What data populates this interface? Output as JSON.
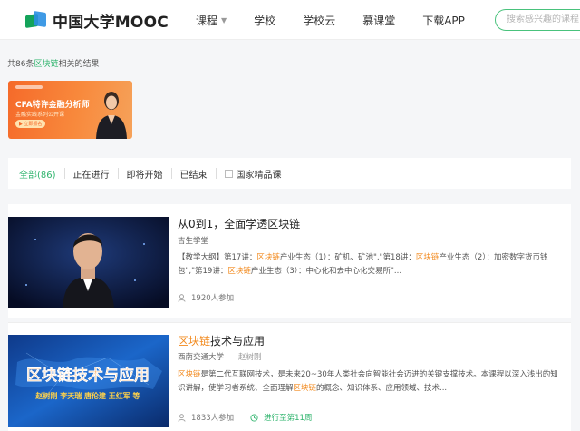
{
  "header": {
    "logo_text": "中国大学MOOC",
    "nav": [
      {
        "label": "课程",
        "has_dropdown": true
      },
      {
        "label": "学校",
        "has_dropdown": false
      },
      {
        "label": "学校云",
        "has_dropdown": false
      },
      {
        "label": "慕课堂",
        "has_dropdown": false
      },
      {
        "label": "下载APP",
        "has_dropdown": false
      }
    ],
    "search_placeholder": "搜索感兴趣的课程"
  },
  "results": {
    "prefix": "共86条",
    "keyword": "区块链",
    "suffix": "相关的结果"
  },
  "banner": {
    "title": "CFA特许金融分析师",
    "subtitle": "金融实践系列公开课",
    "tag": "▶ 立即报名"
  },
  "filters": {
    "items": [
      {
        "label": "全部(86)",
        "active": true
      },
      {
        "label": "正在进行",
        "active": false
      },
      {
        "label": "即将开始",
        "active": false
      },
      {
        "label": "已结束",
        "active": false
      }
    ],
    "checkbox_label": "国家精品课"
  },
  "courses": [
    {
      "title": "从0到1，全面学透区块链",
      "school": "吉生学堂",
      "teacher": "",
      "desc_parts": [
        {
          "t": "【教学大纲】第17讲：",
          "hl": false
        },
        {
          "t": "区块链",
          "hl": true
        },
        {
          "t": "产业生态（1）：矿机、矿池\",\"第18讲：",
          "hl": false
        },
        {
          "t": "区块链",
          "hl": true
        },
        {
          "t": "产业生态（2）：加密数字货币钱包\",\"第19讲：",
          "hl": false
        },
        {
          "t": "区块链",
          "hl": true
        },
        {
          "t": "产业生态（3）：中心化和去中心化交易所\"...",
          "hl": false
        }
      ],
      "enrolled": "1920人参加",
      "progress": ""
    },
    {
      "title_keyword": "区块链",
      "title_rest": "技术与应用",
      "school": "西南交通大学",
      "teacher": "赵树刚",
      "desc_parts": [
        {
          "t": "区块链",
          "hl": true
        },
        {
          "t": "是第二代互联网技术，是未来20~30年人类社会向智能社会迈进的关键支撑技术。本课程以深入浅出的知识讲解，使学习者系统、全面理解",
          "hl": false
        },
        {
          "t": "区块链",
          "hl": true
        },
        {
          "t": "的概念、知识体系、应用领域、技术...",
          "hl": false
        }
      ],
      "enrolled": "1833人参加",
      "progress": "进行至第11周",
      "thumb_text": "区块链技术与应用",
      "thumb_names": "赵树刚  李天瑞  唐伦建  王红军 等"
    }
  ],
  "colors": {
    "accent": "#2fb46d",
    "highlight": "#f28a1e",
    "banner": "#f56a2a"
  }
}
